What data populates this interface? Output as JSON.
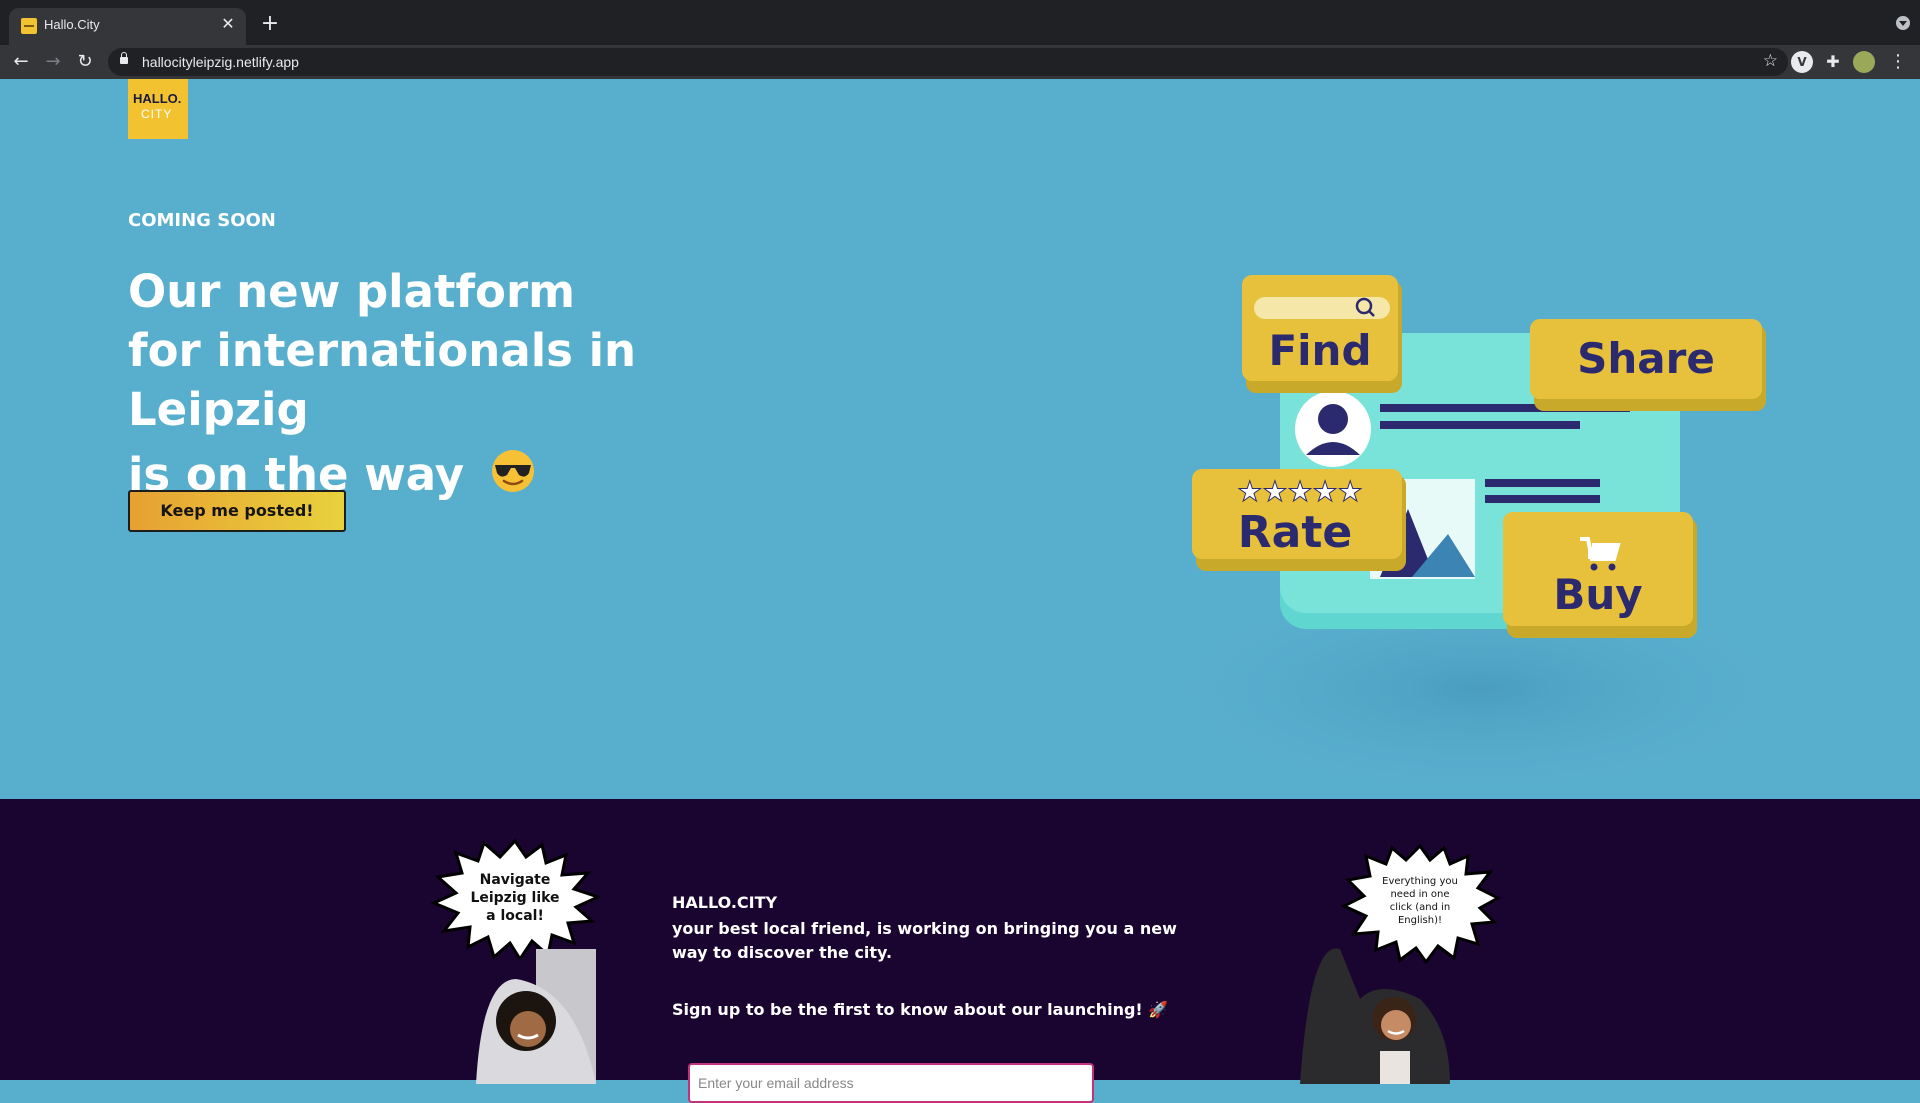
{
  "browser": {
    "tab_title": "Hallo.City",
    "tab_close": "✕",
    "new_tab": "+",
    "url": "hallocityleipzig.netlify.app",
    "back": "←",
    "forward": "→",
    "reload": "↻",
    "star": "☆",
    "extensions": "✚",
    "menu": "⋮"
  },
  "hero": {
    "logo_line1": "HALLO.",
    "logo_line2": "CITY",
    "coming_soon": "COMING SOON",
    "headline_line1": "Our new platform",
    "headline_line2": "for internationals in Leipzig",
    "headline_line3": "is on the way",
    "cta_label": "Keep me posted!",
    "illustration": {
      "find": "Find",
      "share": "Share",
      "rate": "Rate",
      "buy": "Buy",
      "stars": "★★★★★"
    }
  },
  "section": {
    "burst_left": [
      "Navigate",
      "Leipzig like",
      "a local!"
    ],
    "burst_right": [
      "Everything you",
      "need in one",
      "click (and in",
      "English)!"
    ],
    "brand": "HALLO.CITY",
    "tagline": "your best local friend, is working on bringing you a new way to discover the city.",
    "signup": "Sign up to be the first to know about our launching! 🚀",
    "email_placeholder": "Enter your email address"
  },
  "colors": {
    "hero_bg": "#58aecd",
    "dark_bg": "#1a0530",
    "accent_yellow": "#f2c230",
    "navy": "#2b2b6e"
  }
}
